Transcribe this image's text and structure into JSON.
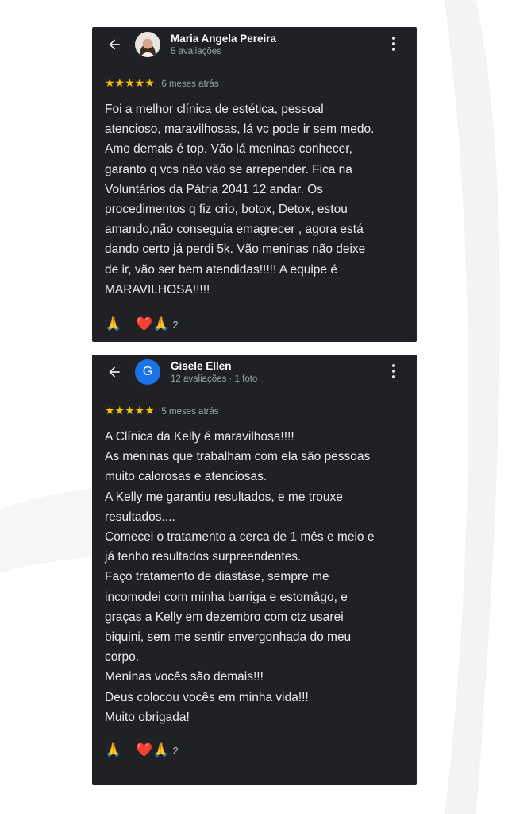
{
  "reviews": [
    {
      "author": "Maria Angela Pereira",
      "meta": "5 avaliações",
      "stars": "★★★★★",
      "time": "6 meses atrás",
      "text_lines": [
        "Foi a melhor clínica de estética, pessoal",
        "atencioso, maravilhosas, lá vc pode ir sem medo.",
        "Amo demais é top. Vão lá meninas conhecer,",
        "garanto q vcs não vão se arrepender. Fica na",
        "Voluntários da Pátria 2041 12 andar. Os",
        "procedimentos q fiz crio, botox, Detox, estou",
        "amando,não conseguia emagrecer , agora está",
        "dando certo já perdi 5k. Vão meninas não deixe",
        "de ir, vão ser bem atendidas!!!!! A equipe é",
        "MARAVILHOSA!!!!!"
      ],
      "reaction_1": "🙏",
      "reaction_2": "❤️🙏",
      "reaction_count": "2"
    },
    {
      "author": "Gisele Ellen",
      "avatar_letter": "G",
      "meta": "12 avaliações · 1 foto",
      "stars": "★★★★★",
      "time": "5 meses atrás",
      "text_lines": [
        "A Clínica da Kelly é maravilhosa!!!!",
        "As meninas que trabalham com ela são pessoas",
        "muito calorosas e atenciosas.",
        "A Kelly me garantiu resultados, e me trouxe",
        "resultados....",
        "Comecei o tratamento a cerca de 1 mês e meio e",
        "já tenho resultados surpreendentes.",
        "Faço tratamento de diastáse, sempre me",
        "incomodei com minha barriga e estomâgo, e",
        "graças a Kelly em dezembro com ctz usarei",
        "biquini, sem me sentir envergonhada do meu",
        "corpo.",
        "Meninas vocês são demais!!!",
        "Deus colocou vocês em minha vida!!!",
        "Muito obrigada!"
      ],
      "reaction_1": "🙏",
      "reaction_2": "❤️🙏",
      "reaction_count": "2"
    }
  ],
  "colors": {
    "card_bg": "#202124",
    "star": "#fbbc04",
    "avatar_g": "#1a73e8"
  },
  "icons": [
    "back-arrow-icon",
    "more-vert-icon",
    "star-icon",
    "praying-hands-icon",
    "heart-icon"
  ]
}
